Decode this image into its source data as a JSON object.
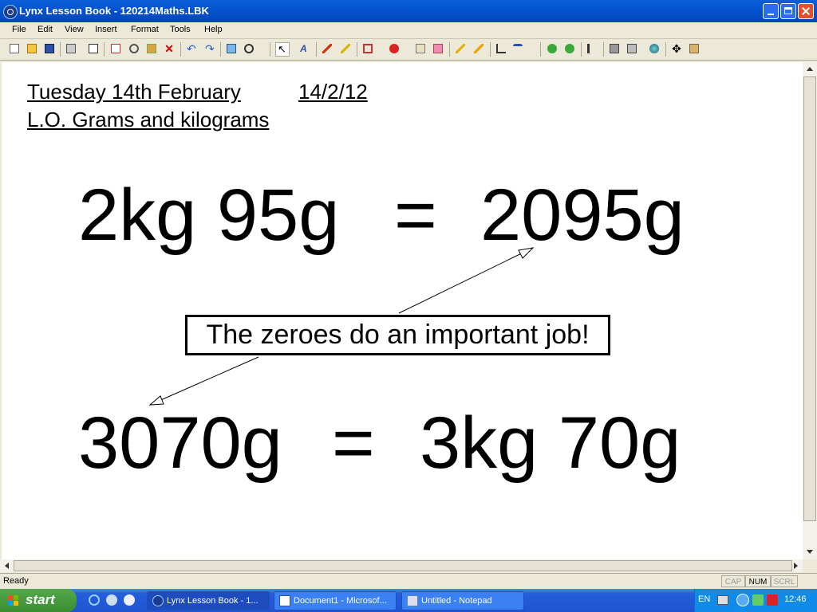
{
  "window": {
    "title": "Lynx Lesson Book - 120214Maths.LBK"
  },
  "menu": [
    "File",
    "Edit",
    "View",
    "Insert",
    "Format",
    "Tools",
    "Help"
  ],
  "toolbar_icons": [
    "new-file-icon",
    "open-folder-icon",
    "save-icon",
    "print-icon",
    "page-icon",
    "copy-icon",
    "cut-icon",
    "paste-icon",
    "delete-icon",
    "undo-icon",
    "redo-icon",
    "insert-picture-icon",
    "zoom-icon",
    "pointer-icon",
    "text-icon",
    "pen-icon",
    "highlighter-icon",
    "shape-icon",
    "fill-color-icon",
    "paint-bucket-icon",
    "eraser-icon",
    "marker-yellow-icon",
    "marker-orange-icon",
    "crop-icon",
    "line-style-icon",
    "back-icon",
    "forward-icon",
    "sound-icon",
    "keyboard-icon",
    "calculator-icon",
    "globe-icon",
    "move-icon",
    "tools-icon"
  ],
  "canvas": {
    "heading_date": "Tuesday 14th February",
    "heading_date_num": "14/2/12",
    "heading_lo": "L.O. Grams and kilograms",
    "eq1": {
      "left": "2kg 95g",
      "sign": "=",
      "right": "2095g"
    },
    "eq2": {
      "left": "3070g",
      "sign": "=",
      "right": "3kg 70g"
    },
    "note": "The zeroes do an important job!"
  },
  "status": {
    "text": "Ready",
    "cap": "CAP",
    "num": "NUM",
    "scrl": "SCRL"
  },
  "taskbar": {
    "start_label": "start",
    "tasks": [
      {
        "label": "Lynx Lesson Book - 1...",
        "icon": "lynx-icon"
      },
      {
        "label": "Document1 - Microsof...",
        "icon": "word-icon"
      },
      {
        "label": "Untitled - Notepad",
        "icon": "notepad-icon"
      }
    ],
    "language": "EN",
    "clock": "12:46"
  }
}
